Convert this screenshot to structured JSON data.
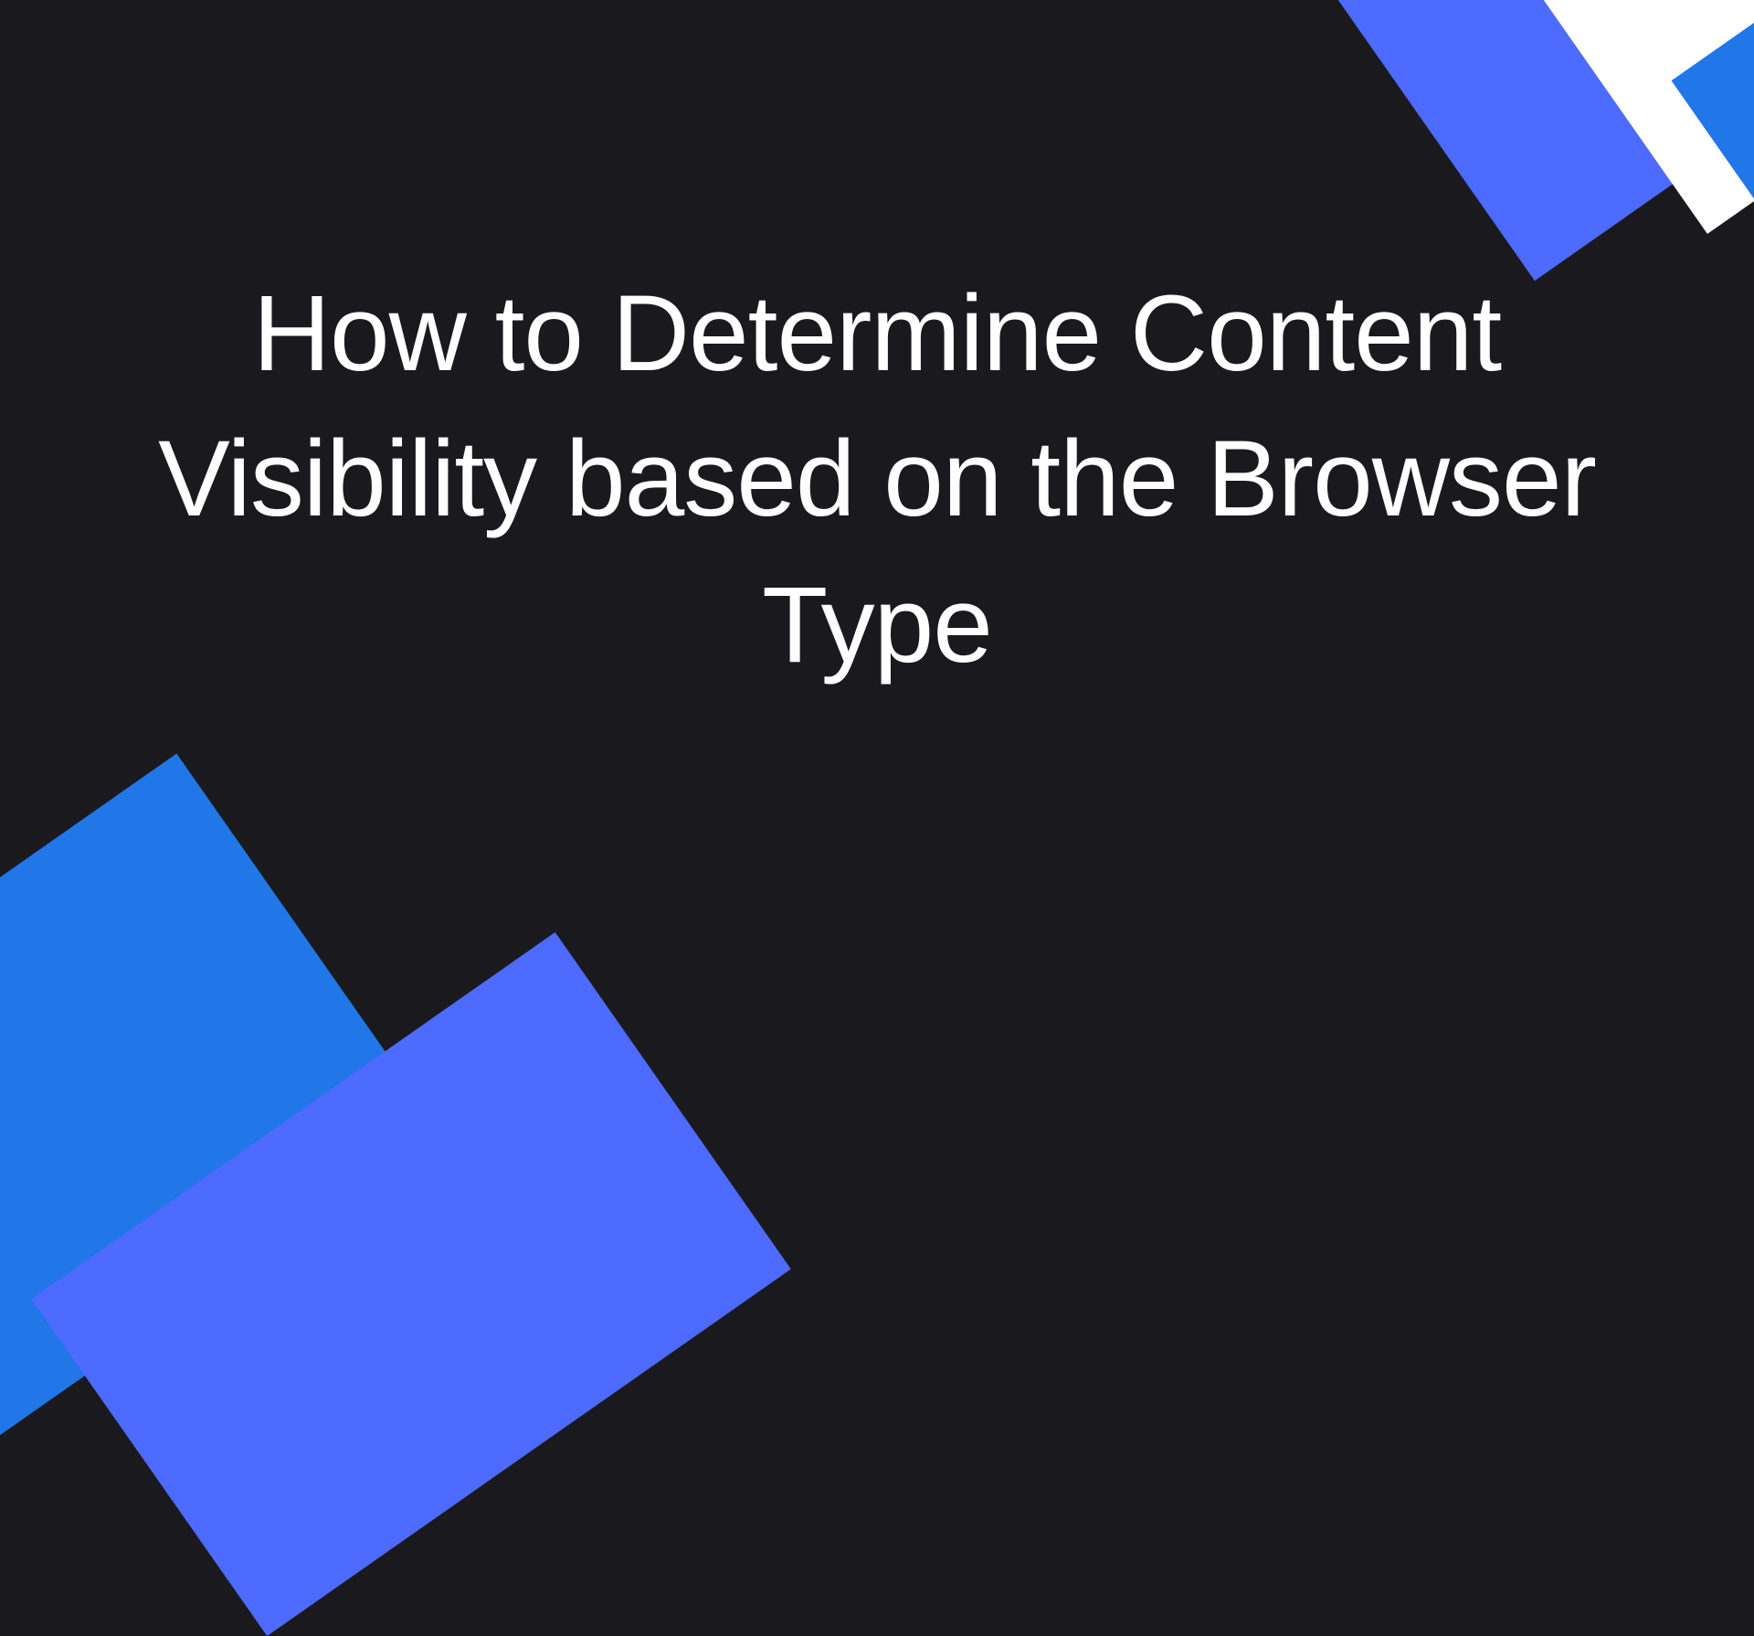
{
  "slide": {
    "title": "How to Determine Content Visibility based on the Browser Type"
  },
  "colors": {
    "background": "#1a1a1e",
    "text": "#ffffff",
    "accent_blue": "#2176e8",
    "accent_purple": "#4d6bff",
    "accent_white": "#ffffff"
  }
}
